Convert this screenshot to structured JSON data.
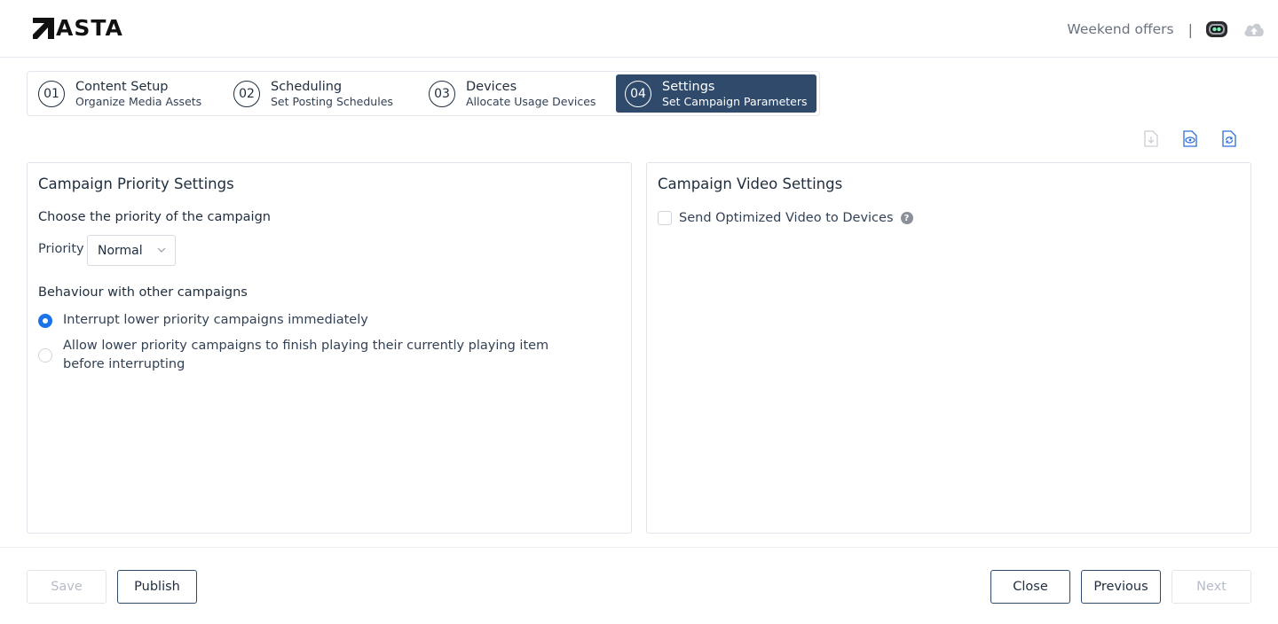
{
  "header": {
    "logo_text": "ASTA",
    "campaign_name": "Weekend offers",
    "separator": "|",
    "icons": [
      "record-icon",
      "cloud-upload-icon"
    ]
  },
  "stepper": {
    "steps": [
      {
        "num": "01",
        "title": "Content Setup",
        "sub": "Organize Media Assets",
        "active": false
      },
      {
        "num": "02",
        "title": "Scheduling",
        "sub": "Set Posting Schedules",
        "active": false
      },
      {
        "num": "03",
        "title": "Devices",
        "sub": "Allocate Usage Devices",
        "active": false
      },
      {
        "num": "04",
        "title": "Settings",
        "sub": "Set Campaign Parameters",
        "active": true
      }
    ]
  },
  "toolbar": {
    "icons": [
      "download-file-icon",
      "preview-file-icon",
      "refresh-file-icon"
    ]
  },
  "priority_panel": {
    "title": "Campaign Priority Settings",
    "choose_label": "Choose the priority of the campaign",
    "priority_label": "Priority",
    "priority_value": "Normal",
    "behaviour_label": "Behaviour with other campaigns",
    "options": [
      {
        "label": "Interrupt lower priority campaigns immediately",
        "checked": true
      },
      {
        "label": "Allow lower priority campaigns to finish playing their currently playing item before interrupting",
        "checked": false
      }
    ]
  },
  "video_panel": {
    "title": "Campaign Video Settings",
    "checkbox_label": "Send Optimized Video to Devices",
    "checkbox_checked": false,
    "help_glyph": "?"
  },
  "footer": {
    "save_label": "Save",
    "publish_label": "Publish",
    "close_label": "Close",
    "previous_label": "Previous",
    "next_label": "Next"
  },
  "colors": {
    "accent": "#2f4a6b",
    "radio_checked": "#1a73e8",
    "disabled_text": "#b6bcc6"
  }
}
